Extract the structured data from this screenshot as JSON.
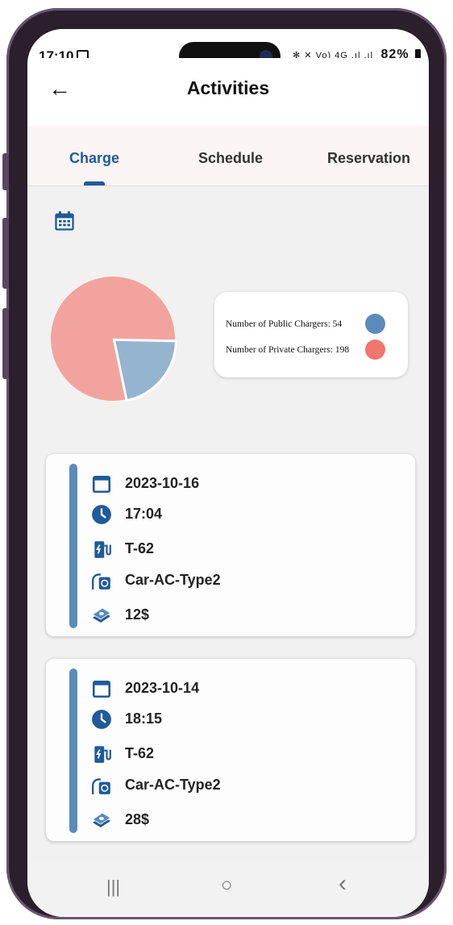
{
  "status": {
    "time": "17:10",
    "battery": "82%",
    "indicators": "✻ ✕ Vo) 4G .ıl .ıl"
  },
  "header": {
    "title": "Activities",
    "back_icon": "back-arrow-icon"
  },
  "tabs": [
    {
      "label": "Charge",
      "active": true
    },
    {
      "label": "Schedule",
      "active": false
    },
    {
      "label": "Reservation",
      "active": false
    }
  ],
  "colors": {
    "accent": "#1f5a9a",
    "public": "#5b8bbd",
    "private": "#f0766e",
    "pie_public": "#94b4d0",
    "pie_private": "#f3a39e"
  },
  "chart_data": {
    "type": "pie",
    "slices": [
      {
        "label": "Number of Public Chargers",
        "value": 54
      },
      {
        "label": "Number of Private Chargers",
        "value": 198
      }
    ]
  },
  "legend": [
    {
      "label": "Number of Public Chargers: 54"
    },
    {
      "label": "Number of Private Chargers: 198"
    }
  ],
  "sessions": [
    {
      "date": "2023-10-16",
      "time": "17:04",
      "charger": "T-62",
      "connector": "Car-AC-Type2",
      "cost": "12$"
    },
    {
      "date": "2023-10-14",
      "time": "18:15",
      "charger": "T-62",
      "connector": "Car-AC-Type2",
      "cost": "28$"
    }
  ],
  "navbar": {
    "recent": "|||",
    "home": "○",
    "back": "‹"
  }
}
